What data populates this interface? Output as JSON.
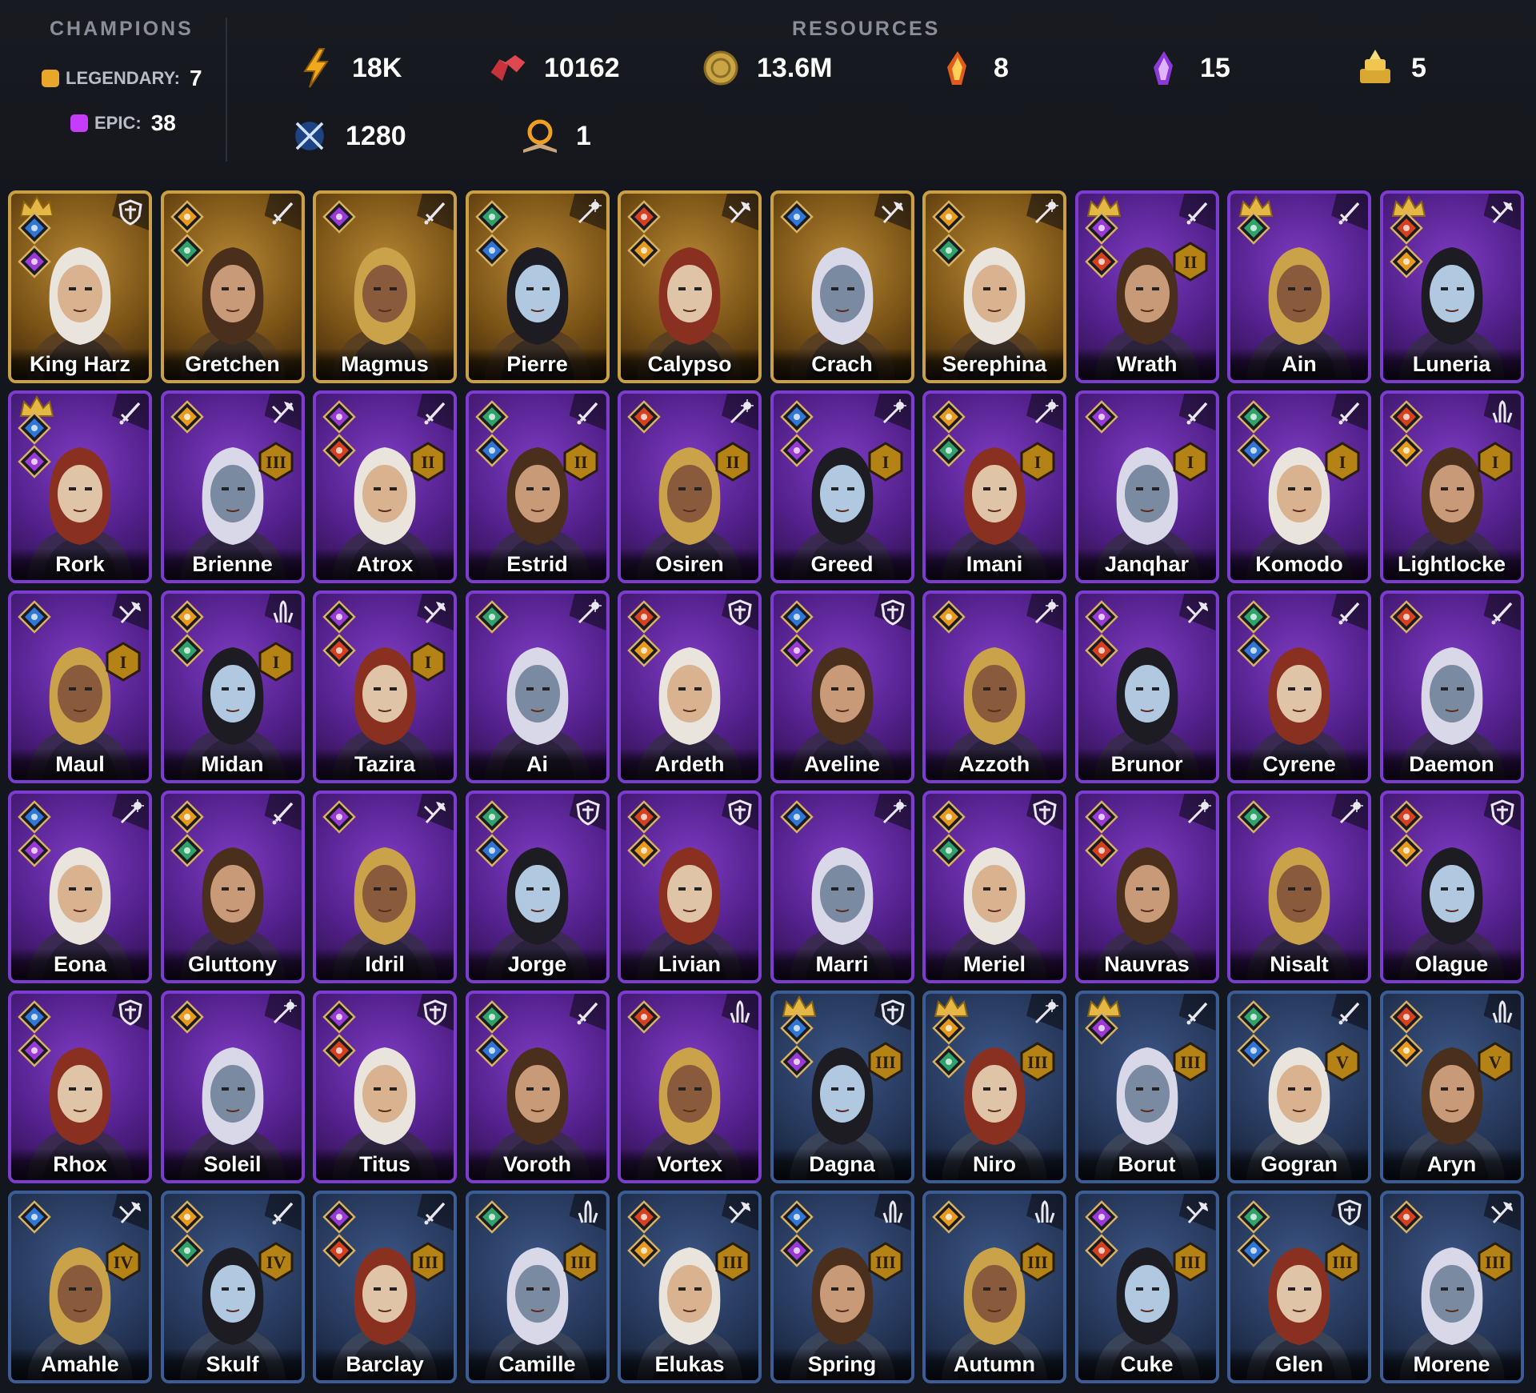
{
  "champions": {
    "title": "CHAMPIONS",
    "legendary_label": "LEGENDARY:",
    "legendary_count": "7",
    "epic_label": "EPIC:",
    "epic_count": "38"
  },
  "resources": {
    "title": "RESOURCES",
    "items": [
      {
        "icon": "energy-icon",
        "value": "18K"
      },
      {
        "icon": "ruby-icon",
        "value": "10162"
      },
      {
        "icon": "silver-coin-icon",
        "value": "13.6M"
      },
      {
        "icon": "fire-shard-icon",
        "value": "8"
      },
      {
        "icon": "void-shard-icon",
        "value": "15"
      },
      {
        "icon": "gold-stack-icon",
        "value": "5"
      },
      {
        "icon": "arena-swords-icon",
        "value": "1280"
      },
      {
        "icon": "tome-icon",
        "value": "1"
      }
    ]
  },
  "colors": {
    "legendary": "#caa045",
    "epic": "#7b3ccf",
    "rare": "#3c5c95"
  },
  "cards": [
    {
      "name": "King Harz",
      "rarity": "legendary",
      "crown": true,
      "class": "shield-icon",
      "rank": ""
    },
    {
      "name": "Gretchen",
      "rarity": "legendary",
      "crown": false,
      "class": "sword-icon",
      "rank": ""
    },
    {
      "name": "Magmus",
      "rarity": "legendary",
      "crown": false,
      "class": "sword-icon",
      "rank": ""
    },
    {
      "name": "Pierre",
      "rarity": "legendary",
      "crown": false,
      "class": "staff-icon",
      "rank": ""
    },
    {
      "name": "Calypso",
      "rarity": "legendary",
      "crown": false,
      "class": "axe-icon",
      "rank": ""
    },
    {
      "name": "Crach",
      "rarity": "legendary",
      "crown": false,
      "class": "axe-icon",
      "rank": ""
    },
    {
      "name": "Serephina",
      "rarity": "legendary",
      "crown": false,
      "class": "staff-icon",
      "rank": ""
    },
    {
      "name": "Wrath",
      "rarity": "epic",
      "crown": true,
      "class": "sword-icon",
      "rank": "II"
    },
    {
      "name": "Ain",
      "rarity": "epic",
      "crown": true,
      "class": "sword-icon",
      "rank": ""
    },
    {
      "name": "Luneria",
      "rarity": "epic",
      "crown": true,
      "class": "axe-icon",
      "rank": ""
    },
    {
      "name": "Rork",
      "rarity": "epic",
      "crown": true,
      "class": "sword-icon",
      "rank": ""
    },
    {
      "name": "Brienne",
      "rarity": "epic",
      "crown": false,
      "class": "axe-icon",
      "rank": "III"
    },
    {
      "name": "Atrox",
      "rarity": "epic",
      "crown": false,
      "class": "sword-icon",
      "rank": "II"
    },
    {
      "name": "Estrid",
      "rarity": "epic",
      "crown": false,
      "class": "sword-icon",
      "rank": "II"
    },
    {
      "name": "Osiren",
      "rarity": "epic",
      "crown": false,
      "class": "staff-icon",
      "rank": "II"
    },
    {
      "name": "Greed",
      "rarity": "epic",
      "crown": false,
      "class": "staff-icon",
      "rank": "I"
    },
    {
      "name": "Imani",
      "rarity": "epic",
      "crown": false,
      "class": "staff-icon",
      "rank": "I"
    },
    {
      "name": "Janqhar",
      "rarity": "epic",
      "crown": false,
      "class": "sword-icon",
      "rank": "I"
    },
    {
      "name": "Komodo",
      "rarity": "epic",
      "crown": false,
      "class": "sword-icon",
      "rank": "I"
    },
    {
      "name": "Lightlocke",
      "rarity": "epic",
      "crown": false,
      "class": "hands-icon",
      "rank": "I"
    },
    {
      "name": "Maul",
      "rarity": "epic",
      "crown": false,
      "class": "axe-icon",
      "rank": "I"
    },
    {
      "name": "Midan",
      "rarity": "epic",
      "crown": false,
      "class": "hands-icon",
      "rank": "I"
    },
    {
      "name": "Tazira",
      "rarity": "epic",
      "crown": false,
      "class": "axe-icon",
      "rank": "I"
    },
    {
      "name": "Ai",
      "rarity": "epic",
      "crown": false,
      "class": "staff-icon",
      "rank": ""
    },
    {
      "name": "Ardeth",
      "rarity": "epic",
      "crown": false,
      "class": "shield-icon",
      "rank": ""
    },
    {
      "name": "Aveline",
      "rarity": "epic",
      "crown": false,
      "class": "shield-icon",
      "rank": ""
    },
    {
      "name": "Azzoth",
      "rarity": "epic",
      "crown": false,
      "class": "staff-icon",
      "rank": ""
    },
    {
      "name": "Brunor",
      "rarity": "epic",
      "crown": false,
      "class": "axe-icon",
      "rank": ""
    },
    {
      "name": "Cyrene",
      "rarity": "epic",
      "crown": false,
      "class": "sword-icon",
      "rank": ""
    },
    {
      "name": "Daemon",
      "rarity": "epic",
      "crown": false,
      "class": "sword-icon",
      "rank": ""
    },
    {
      "name": "Eona",
      "rarity": "epic",
      "crown": false,
      "class": "staff-icon",
      "rank": ""
    },
    {
      "name": "Gluttony",
      "rarity": "epic",
      "crown": false,
      "class": "sword-icon",
      "rank": ""
    },
    {
      "name": "Idril",
      "rarity": "epic",
      "crown": false,
      "class": "axe-icon",
      "rank": ""
    },
    {
      "name": "Jorge",
      "rarity": "epic",
      "crown": false,
      "class": "shield-icon",
      "rank": ""
    },
    {
      "name": "Livian",
      "rarity": "epic",
      "crown": false,
      "class": "shield-icon",
      "rank": ""
    },
    {
      "name": "Marri",
      "rarity": "epic",
      "crown": false,
      "class": "staff-icon",
      "rank": ""
    },
    {
      "name": "Meriel",
      "rarity": "epic",
      "crown": false,
      "class": "shield-icon",
      "rank": ""
    },
    {
      "name": "Nauvras",
      "rarity": "epic",
      "crown": false,
      "class": "staff-icon",
      "rank": ""
    },
    {
      "name": "Nisalt",
      "rarity": "epic",
      "crown": false,
      "class": "staff-icon",
      "rank": ""
    },
    {
      "name": "Olague",
      "rarity": "epic",
      "crown": false,
      "class": "shield-icon",
      "rank": ""
    },
    {
      "name": "Rhox",
      "rarity": "epic",
      "crown": false,
      "class": "shield-icon",
      "rank": ""
    },
    {
      "name": "Soleil",
      "rarity": "epic",
      "crown": false,
      "class": "staff-icon",
      "rank": ""
    },
    {
      "name": "Titus",
      "rarity": "epic",
      "crown": false,
      "class": "shield-icon",
      "rank": ""
    },
    {
      "name": "Voroth",
      "rarity": "epic",
      "crown": false,
      "class": "sword-icon",
      "rank": ""
    },
    {
      "name": "Vortex",
      "rarity": "epic",
      "crown": false,
      "class": "hands-icon",
      "rank": ""
    },
    {
      "name": "Dagna",
      "rarity": "rare",
      "crown": true,
      "class": "shield-icon",
      "rank": "III"
    },
    {
      "name": "Niro",
      "rarity": "rare",
      "crown": true,
      "class": "staff-icon",
      "rank": "III"
    },
    {
      "name": "Borut",
      "rarity": "rare",
      "crown": true,
      "class": "sword-icon",
      "rank": "III"
    },
    {
      "name": "Gogran",
      "rarity": "rare",
      "crown": false,
      "class": "sword-icon",
      "rank": "V"
    },
    {
      "name": "Aryn",
      "rarity": "rare",
      "crown": false,
      "class": "hands-icon",
      "rank": "V"
    },
    {
      "name": "Amahle",
      "rarity": "rare",
      "crown": false,
      "class": "axe-icon",
      "rank": "IV"
    },
    {
      "name": "Skulf",
      "rarity": "rare",
      "crown": false,
      "class": "sword-icon",
      "rank": "IV"
    },
    {
      "name": "Barclay",
      "rarity": "rare",
      "crown": false,
      "class": "sword-icon",
      "rank": "III"
    },
    {
      "name": "Camille",
      "rarity": "rare",
      "crown": false,
      "class": "hands-icon",
      "rank": "III"
    },
    {
      "name": "Elukas",
      "rarity": "rare",
      "crown": false,
      "class": "axe-icon",
      "rank": "III"
    },
    {
      "name": "Spring",
      "rarity": "rare",
      "crown": false,
      "class": "hands-icon",
      "rank": "III"
    },
    {
      "name": "Autumn",
      "rarity": "rare",
      "crown": false,
      "class": "hands-icon",
      "rank": "III"
    },
    {
      "name": "Cuke",
      "rarity": "rare",
      "crown": false,
      "class": "axe-icon",
      "rank": "III"
    },
    {
      "name": "Glen",
      "rarity": "rare",
      "crown": false,
      "class": "shield-icon",
      "rank": "III"
    },
    {
      "name": "Morene",
      "rarity": "rare",
      "crown": false,
      "class": "axe-icon",
      "rank": "III"
    }
  ]
}
